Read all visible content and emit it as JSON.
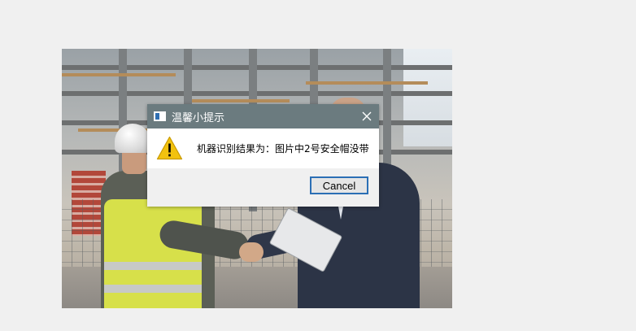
{
  "dialog": {
    "title": "温馨小提示",
    "message": "机器识别结果为：图片中2号安全帽没带",
    "cancel_label": "Cancel",
    "icon": "warning-icon",
    "close_icon": "close-icon",
    "app_icon": "window-icon"
  },
  "colors": {
    "titlebar": "#6b7b7f",
    "button_border": "#2b6fb5",
    "warning_fill": "#f2c20f"
  }
}
